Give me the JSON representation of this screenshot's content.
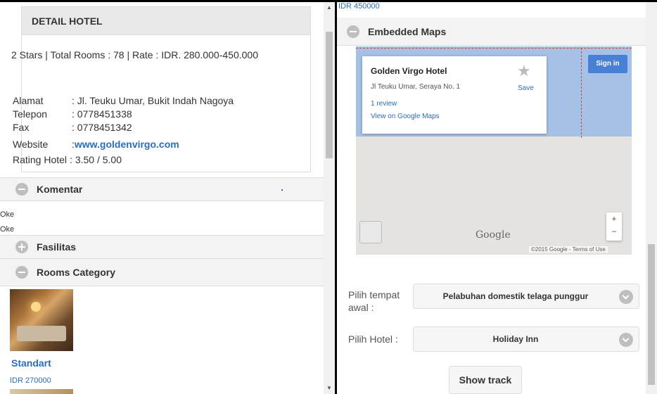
{
  "detail": {
    "header": "DETAIL HOTEL",
    "summary": "2 Stars | Total Rooms : 78 | Rate : IDR. 280.000-450.000",
    "rows": [
      {
        "label": "Alamat",
        "value": ": Jl. Teuku Umar, Bukit Indah Nagoya"
      },
      {
        "label": "Telepon",
        "value": ": 0778451338"
      },
      {
        "label": "Fax",
        "value": ": 0778451342"
      },
      {
        "label": "Website",
        "value": ": ",
        "link": "www.goldenvirgo.com"
      },
      {
        "label": "Rating Hotel",
        "value": ": 3.50 / 5.00"
      }
    ]
  },
  "sections": {
    "komentar": "Komentar",
    "fasilitas": "Fasilitas",
    "rooms_category": "Rooms Category"
  },
  "comments": [
    "Oke",
    "Oke"
  ],
  "room": {
    "name": "Standart",
    "price": "IDR 270000"
  },
  "right": {
    "top_price": "IDR 450000",
    "maps_header": "Embedded Maps",
    "map": {
      "place_name": "Golden Virgo Hotel",
      "address": "Jl Teuku Umar, Seraya No. 1",
      "review": "1 review",
      "view_link": "View on Google Maps",
      "save": "Save",
      "sign_in": "Sign in",
      "logo": "Google",
      "attribution": "©2015 Google -   Terms of Use",
      "zoom_in": "+",
      "zoom_out": "−"
    },
    "form": {
      "start_label": "Pilih tempat awal :",
      "start_value": "Pelabuhan domestik telaga punggur",
      "hotel_label": "Pilih Hotel :",
      "hotel_value": "Holiday Inn",
      "button": "Show track"
    }
  },
  "colors": {
    "link": "#2a6ebb",
    "header_bg": "#e9e9e9",
    "signin_bg": "#4a7fd6"
  }
}
